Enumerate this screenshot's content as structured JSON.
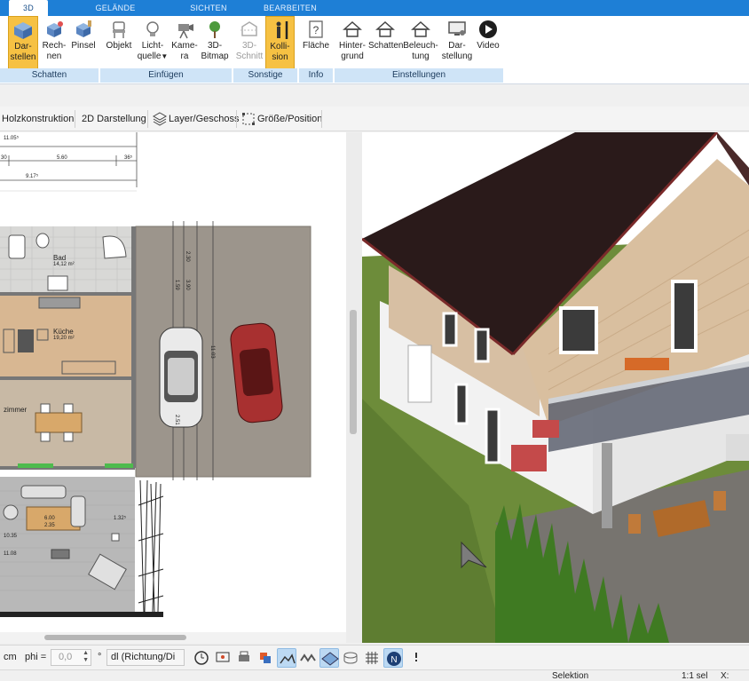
{
  "tabs": [
    "3D",
    "GELÄNDE",
    "SICHTEN",
    "BEARBEITEN"
  ],
  "ribbon": {
    "buttons": [
      {
        "label1": "Dar-",
        "label2": "stellen",
        "icon": "cube-icon"
      },
      {
        "label1": "Rech-",
        "label2": "nen",
        "icon": "cube-compute-icon"
      },
      {
        "label1": "Pinsel",
        "label2": "",
        "icon": "brush-cube-icon"
      },
      {
        "label1": "Objekt",
        "label2": "",
        "icon": "chair-icon"
      },
      {
        "label1": "Licht-",
        "label2": "quelle",
        "icon": "lightbulb-icon"
      },
      {
        "label1": "Kame-",
        "label2": "ra",
        "icon": "camera-icon"
      },
      {
        "label1": "3D-",
        "label2": "Bitmap",
        "icon": "tree-icon"
      },
      {
        "label1": "3D-",
        "label2": "Schnitt",
        "icon": "section-cut-icon"
      },
      {
        "label1": "Kolli-",
        "label2": "sion",
        "icon": "person-collision-icon"
      },
      {
        "label1": "Fläche",
        "label2": "",
        "icon": "question-page-icon"
      },
      {
        "label1": "Hinter-",
        "label2": "grund",
        "icon": "house-background-icon"
      },
      {
        "label1": "Schatten",
        "label2": "",
        "icon": "house-shadow-icon"
      },
      {
        "label1": "Beleuch-",
        "label2": "tung",
        "icon": "house-light-icon"
      },
      {
        "label1": "Dar-",
        "label2": "stellung",
        "icon": "monitor-icon"
      },
      {
        "label1": "Video",
        "label2": "",
        "icon": "play-icon"
      }
    ],
    "groups": [
      "Schatten",
      "Einfügen",
      "Sonstige",
      "Info",
      "Einstellungen"
    ]
  },
  "toolbar2": {
    "holz": "Holzkonstruktion",
    "darst2d": "2D Darstellung",
    "layer": "Layer/Geschoss",
    "groesse": "Größe/Position"
  },
  "plan": {
    "dims": [
      "11.05⁵",
      "5.60",
      "9.17⁵",
      "30",
      "36⁵"
    ],
    "rooms": [
      {
        "name": "Bad",
        "area": "14,12 m²"
      },
      {
        "name": "Küche",
        "area": "19,20 m²"
      },
      {
        "name": "zimmer",
        "area": ""
      }
    ],
    "labels": [
      "6.00",
      "2.35",
      "10.35",
      "11.08",
      "1.32⁵",
      "11.03",
      "2.51",
      "1.59",
      "2.30",
      "3.90"
    ]
  },
  "bottom": {
    "unit": "cm",
    "phi_label": "phi =",
    "phi_value": "0,0",
    "degree": "°",
    "direction": "dl (Richtung/Di"
  },
  "status": {
    "mode": "Selektion",
    "scale": "1:1 sel",
    "x_label": "X:"
  },
  "colors": {
    "tab_bar": "#1e7fd6",
    "active_button": "#f6c143",
    "group_band": "#cfe4f7"
  }
}
